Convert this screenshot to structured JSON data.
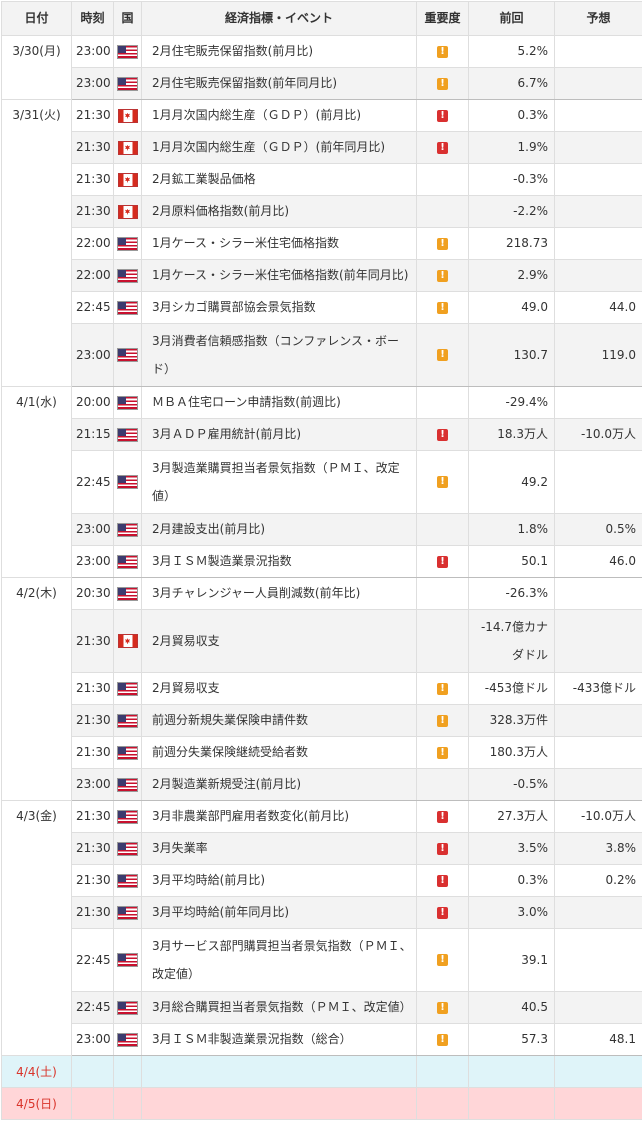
{
  "headers": {
    "date": "日付",
    "time": "時刻",
    "country": "国",
    "event": "経済指標・イベント",
    "importance": "重要度",
    "previous": "前回",
    "forecast": "予想"
  },
  "importance_symbol": "!",
  "colors": {
    "importance_medium": "#f0a020",
    "importance_high": "#d93030",
    "saturday_bg": "#dff4f9",
    "sunday_bg": "#ffd6d8",
    "weekend_text": "#d9342b"
  },
  "groups": [
    {
      "date": "3/30(月)",
      "rows": [
        {
          "time": "23:00",
          "country": "us",
          "event": "2月住宅販売保留指数(前月比)",
          "importance": "medium",
          "previous": "5.2%",
          "forecast": ""
        },
        {
          "time": "23:00",
          "country": "us",
          "event": "2月住宅販売保留指数(前年同月比)",
          "importance": "medium",
          "previous": "6.7%",
          "forecast": ""
        }
      ]
    },
    {
      "date": "3/31(火)",
      "rows": [
        {
          "time": "21:30",
          "country": "ca",
          "event": "1月月次国内総生産（ＧＤＰ）(前月比)",
          "importance": "high",
          "previous": "0.3%",
          "forecast": ""
        },
        {
          "time": "21:30",
          "country": "ca",
          "event": "1月月次国内総生産（ＧＤＰ）(前年同月比)",
          "importance": "high",
          "previous": "1.9%",
          "forecast": ""
        },
        {
          "time": "21:30",
          "country": "ca",
          "event": "2月鉱工業製品価格",
          "importance": "",
          "previous": "-0.3%",
          "forecast": ""
        },
        {
          "time": "21:30",
          "country": "ca",
          "event": "2月原料価格指数(前月比)",
          "importance": "",
          "previous": "-2.2%",
          "forecast": ""
        },
        {
          "time": "22:00",
          "country": "us",
          "event": "1月ケース・シラー米住宅価格指数",
          "importance": "medium",
          "previous": "218.73",
          "forecast": ""
        },
        {
          "time": "22:00",
          "country": "us",
          "event": "1月ケース・シラー米住宅価格指数(前年同月比)",
          "importance": "medium",
          "previous": "2.9%",
          "forecast": ""
        },
        {
          "time": "22:45",
          "country": "us",
          "event": "3月シカゴ購買部協会景気指数",
          "importance": "medium",
          "previous": "49.0",
          "forecast": "44.0"
        },
        {
          "time": "23:00",
          "country": "us",
          "event": "3月消費者信頼感指数（コンファレンス・ボード）",
          "importance": "medium",
          "previous": "130.7",
          "forecast": "119.0",
          "tall": true
        }
      ]
    },
    {
      "date": "4/1(水)",
      "rows": [
        {
          "time": "20:00",
          "country": "us",
          "event": "ＭＢＡ住宅ローン申請指数(前週比)",
          "importance": "",
          "previous": "-29.4%",
          "forecast": ""
        },
        {
          "time": "21:15",
          "country": "us",
          "event": "3月ＡＤＰ雇用統計(前月比)",
          "importance": "high",
          "previous": "18.3万人",
          "forecast": "-10.0万人"
        },
        {
          "time": "22:45",
          "country": "us",
          "event": "3月製造業購買担当者景気指数（ＰＭＩ、改定値）",
          "importance": "medium",
          "previous": "49.2",
          "forecast": "",
          "tall": true
        },
        {
          "time": "23:00",
          "country": "us",
          "event": "2月建設支出(前月比)",
          "importance": "",
          "previous": "1.8%",
          "forecast": "0.5%"
        },
        {
          "time": "23:00",
          "country": "us",
          "event": "3月ＩＳＭ製造業景況指数",
          "importance": "high",
          "previous": "50.1",
          "forecast": "46.0"
        }
      ]
    },
    {
      "date": "4/2(木)",
      "rows": [
        {
          "time": "20:30",
          "country": "us",
          "event": "3月チャレンジャー人員削減数(前年比)",
          "importance": "",
          "previous": "-26.3%",
          "forecast": ""
        },
        {
          "time": "21:30",
          "country": "ca",
          "event": "2月貿易収支",
          "importance": "",
          "previous": "-14.7億カナダドル",
          "forecast": "",
          "tall": true
        },
        {
          "time": "21:30",
          "country": "us",
          "event": "2月貿易収支",
          "importance": "medium",
          "previous": "-453億ドル",
          "forecast": "-433億ドル"
        },
        {
          "time": "21:30",
          "country": "us",
          "event": "前週分新規失業保険申請件数",
          "importance": "medium",
          "previous": "328.3万件",
          "forecast": ""
        },
        {
          "time": "21:30",
          "country": "us",
          "event": "前週分失業保険継続受給者数",
          "importance": "medium",
          "previous": "180.3万人",
          "forecast": ""
        },
        {
          "time": "23:00",
          "country": "us",
          "event": "2月製造業新規受注(前月比)",
          "importance": "",
          "previous": "-0.5%",
          "forecast": ""
        }
      ]
    },
    {
      "date": "4/3(金)",
      "rows": [
        {
          "time": "21:30",
          "country": "us",
          "event": "3月非農業部門雇用者数変化(前月比)",
          "importance": "high",
          "previous": "27.3万人",
          "forecast": "-10.0万人"
        },
        {
          "time": "21:30",
          "country": "us",
          "event": "3月失業率",
          "importance": "high",
          "previous": "3.5%",
          "forecast": "3.8%"
        },
        {
          "time": "21:30",
          "country": "us",
          "event": "3月平均時給(前月比)",
          "importance": "high",
          "previous": "0.3%",
          "forecast": "0.2%"
        },
        {
          "time": "21:30",
          "country": "us",
          "event": "3月平均時給(前年同月比)",
          "importance": "high",
          "previous": "3.0%",
          "forecast": ""
        },
        {
          "time": "22:45",
          "country": "us",
          "event": "3月サービス部門購買担当者景気指数（ＰＭＩ、改定値）",
          "importance": "medium",
          "previous": "39.1",
          "forecast": "",
          "tall": true
        },
        {
          "time": "22:45",
          "country": "us",
          "event": "3月総合購買担当者景気指数（ＰＭＩ、改定値）",
          "importance": "medium",
          "previous": "40.5",
          "forecast": ""
        },
        {
          "time": "23:00",
          "country": "us",
          "event": "3月ＩＳＭ非製造業景況指数（総合）",
          "importance": "medium",
          "previous": "57.3",
          "forecast": "48.1"
        }
      ]
    }
  ],
  "weekend": [
    {
      "date": "4/4(土)",
      "kind": "sat"
    },
    {
      "date": "4/5(日)",
      "kind": "sun"
    }
  ]
}
